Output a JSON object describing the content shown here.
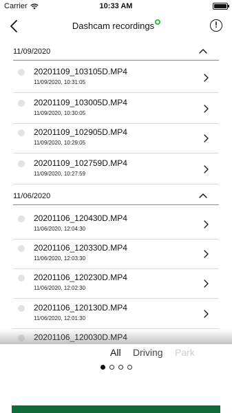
{
  "status_bar": {
    "carrier": "Carrier",
    "time": "10:33 AM"
  },
  "nav": {
    "title": "Dashcam recordings",
    "info_label": "!"
  },
  "sections": [
    {
      "date": "11/09/2020",
      "items": [
        {
          "name": "20201109_103105D.MP4",
          "timestamp": "11/09/2020, 10:31:05"
        },
        {
          "name": "20201109_103005D.MP4",
          "timestamp": "11/09/2020, 10:30:05"
        },
        {
          "name": "20201109_102905D.MP4",
          "timestamp": "11/09/2020, 10:29:05"
        },
        {
          "name": "20201109_102759D.MP4",
          "timestamp": "11/09/2020, 10:27:59"
        }
      ]
    },
    {
      "date": "11/06/2020",
      "items": [
        {
          "name": "20201106_120430D.MP4",
          "timestamp": "11/06/2020, 12:04:30"
        },
        {
          "name": "20201106_120330D.MP4",
          "timestamp": "11/06/2020, 12:03:30"
        },
        {
          "name": "20201106_120230D.MP4",
          "timestamp": "11/06/2020, 12:02:30"
        },
        {
          "name": "20201106_120130D.MP4",
          "timestamp": "11/06/2020, 12:01:30"
        },
        {
          "name": "20201106_120030D.MP4",
          "timestamp": ""
        }
      ]
    }
  ],
  "filters": {
    "all": "All",
    "driving": "Driving",
    "park": "Park"
  },
  "pager": {
    "total": 4,
    "active": 0
  },
  "colors": {
    "accent_green": "#0f6b36",
    "status_dot": "#33bb44"
  }
}
